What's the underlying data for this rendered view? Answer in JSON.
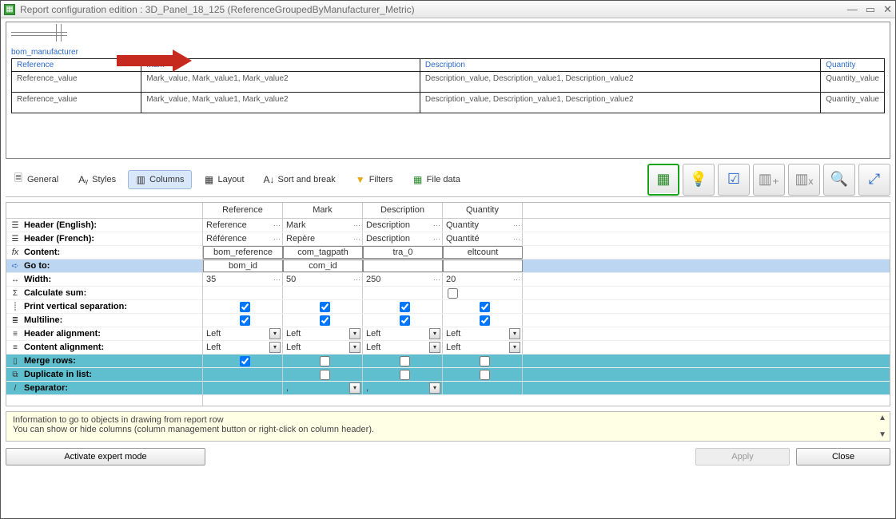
{
  "window": {
    "title": "Report configuration edition : 3D_Panel_18_125 (ReferenceGroupedByManufacturer_Metric)"
  },
  "preview": {
    "bom_label": "bom_manufacturer",
    "headers": [
      "Reference",
      "Mark",
      "Description",
      "Quantity"
    ],
    "rows": [
      {
        "reference": "Reference_value",
        "mark": "Mark_value, Mark_value1, Mark_value2",
        "description": "Description_value, Description_value1, Description_value2",
        "quantity": "Quantity_value"
      },
      {
        "reference": "Reference_value",
        "mark": "Mark_value, Mark_value1, Mark_value2",
        "description": "Description_value, Description_value1, Description_value2",
        "quantity": "Quantity_value"
      }
    ]
  },
  "tabs": {
    "general": "General",
    "styles": "Styles",
    "columns": "Columns",
    "layout": "Layout",
    "sortbreak": "Sort and break",
    "filters": "Filters",
    "filedata": "File data"
  },
  "columns": {
    "headers": {
      "reference": "Reference",
      "mark": "Mark",
      "description": "Description",
      "quantity": "Quantity"
    }
  },
  "props": {
    "header_en": "Header (English):",
    "header_fr": "Header (French):",
    "content": "Content:",
    "goto": "Go to:",
    "width": "Width:",
    "calcsum": "Calculate sum:",
    "printvsep": "Print vertical separation:",
    "multiline": "Multiline:",
    "header_align": "Header alignment:",
    "content_align": "Content alignment:",
    "merge_rows": "Merge rows:",
    "dup_list": "Duplicate in list:",
    "separator": "Separator:"
  },
  "values": {
    "header_en": {
      "r": "Reference",
      "m": "Mark",
      "d": "Description",
      "q": "Quantity"
    },
    "header_fr": {
      "r": "Référence",
      "m": "Repère",
      "d": "Description",
      "q": "Quantité"
    },
    "content": {
      "r": "bom_reference",
      "m": "com_tagpath",
      "d": "tra_0",
      "q": "eltcount"
    },
    "goto": {
      "r": "bom_id",
      "m": "com_id",
      "d": "",
      "q": ""
    },
    "width": {
      "r": "35",
      "m": "50",
      "d": "250",
      "q": "20"
    },
    "align": "Left",
    "sep_val": ","
  },
  "info": {
    "line1": "Information to go to objects in drawing from report row",
    "line2": "You can show or hide columns (column management button or right-click on column header)."
  },
  "buttons": {
    "expert": "Activate expert mode",
    "apply": "Apply",
    "close": "Close"
  }
}
